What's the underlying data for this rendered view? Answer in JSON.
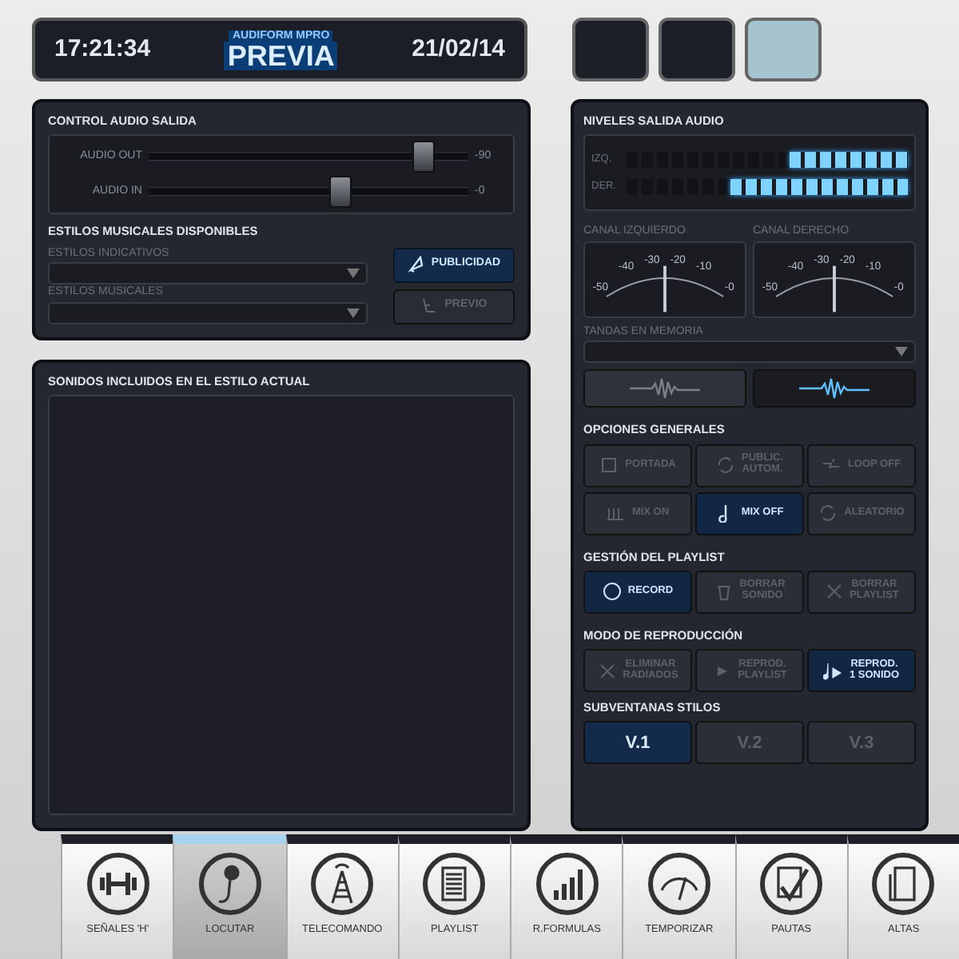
{
  "header": {
    "time": "17:21:34",
    "app_name": "AUDIFORM MPRO",
    "mode": "PREVIA",
    "date": "21/02/14"
  },
  "indicators": [
    {
      "selected": false
    },
    {
      "selected": false
    },
    {
      "selected": true
    }
  ],
  "control_audio": {
    "title": "CONTROL AUDIO SALIDA",
    "sliders": [
      {
        "label": "AUDIO OUT",
        "level": 0.86,
        "reading": "-90"
      },
      {
        "label": "AUDIO IN",
        "level": 0.6,
        "reading": "-0"
      }
    ]
  },
  "estilos": {
    "title": "ESTILOS MUSICALES DISPONIBLES",
    "dropdowns": [
      {
        "label": "ESTILOS INDICATIVOS"
      },
      {
        "label": "ESTILOS MUSICALES"
      }
    ],
    "buttons": [
      {
        "label": "PUBLICIDAD",
        "selected": true
      },
      {
        "label": "PREVIO",
        "selected": false
      }
    ]
  },
  "sonidos": {
    "title": "SONIDOS INCLUIDOS EN EL ESTILO ACTUAL"
  },
  "niveles": {
    "title": "NIVELES SALIDA AUDIO",
    "meters": [
      {
        "label": "IZQ.",
        "level": 0.42
      },
      {
        "label": "DER.",
        "level": 0.63
      }
    ]
  },
  "vu_meters": [
    {
      "label": "CANAL IZQUIERDO",
      "scale": [
        "-50",
        "-40",
        "-30",
        "-20",
        "-10",
        "-0"
      ],
      "level": 0.5
    },
    {
      "label": "CANAL DERECHO",
      "scale": [
        "-50",
        "-40",
        "-30",
        "-20",
        "-10",
        "-0"
      ],
      "level": 0.5
    }
  ],
  "tandas": {
    "label": "TANDAS EN MEMORIA"
  },
  "wave_toggle": [
    {
      "selected": false
    },
    {
      "selected": true
    }
  ],
  "sections": [
    {
      "title": "OPCIONES GENERALES",
      "buttons": [
        {
          "lines": [
            "PORTADA"
          ],
          "selected": false
        },
        {
          "lines": [
            "PUBLIC.",
            "AUTOM."
          ],
          "selected": false
        },
        {
          "lines": [
            "LOOP OFF"
          ],
          "selected": false
        },
        {
          "lines": [
            "MIX ON"
          ],
          "selected": false
        },
        {
          "lines": [
            "MIX OFF"
          ],
          "selected": true
        },
        {
          "lines": [
            "ALEATORIO"
          ],
          "selected": false
        }
      ]
    },
    {
      "title": "GESTIÓN DEL PLAYLIST",
      "buttons": [
        {
          "lines": [
            "RECORD"
          ],
          "selected": true
        },
        {
          "lines": [
            "BORRAR",
            "SONIDO"
          ],
          "selected": false
        },
        {
          "lines": [
            "BORRAR",
            "PLAYLIST"
          ],
          "selected": false
        }
      ]
    },
    {
      "title": "MODO DE REPRODUCCIÓN",
      "buttons": [
        {
          "lines": [
            "ELIMINAR",
            "RADIADOS"
          ],
          "selected": false
        },
        {
          "lines": [
            "REPROD.",
            "PLAYLIST"
          ],
          "selected": false
        },
        {
          "lines": [
            "REPROD.",
            "1 SONIDO"
          ],
          "selected": true
        }
      ]
    }
  ],
  "subventanas": {
    "title": "SUBVENTANAS STILOS",
    "tabs": [
      {
        "label": "V.1",
        "selected": true
      },
      {
        "label": "V.2",
        "selected": false
      },
      {
        "label": "V.3",
        "selected": false
      }
    ]
  },
  "bottom_tabs": [
    {
      "label": "SEÑALES 'H'",
      "selected": false
    },
    {
      "label": "LOCUTAR",
      "selected": true
    },
    {
      "label": "TELECOMANDO",
      "selected": false
    },
    {
      "label": "PLAYLIST",
      "selected": false
    },
    {
      "label": "R.FORMULAS",
      "selected": false
    },
    {
      "label": "TEMPORIZAR",
      "selected": false
    },
    {
      "label": "PAUTAS",
      "selected": false
    },
    {
      "label": "ALTAS",
      "selected": false
    }
  ]
}
